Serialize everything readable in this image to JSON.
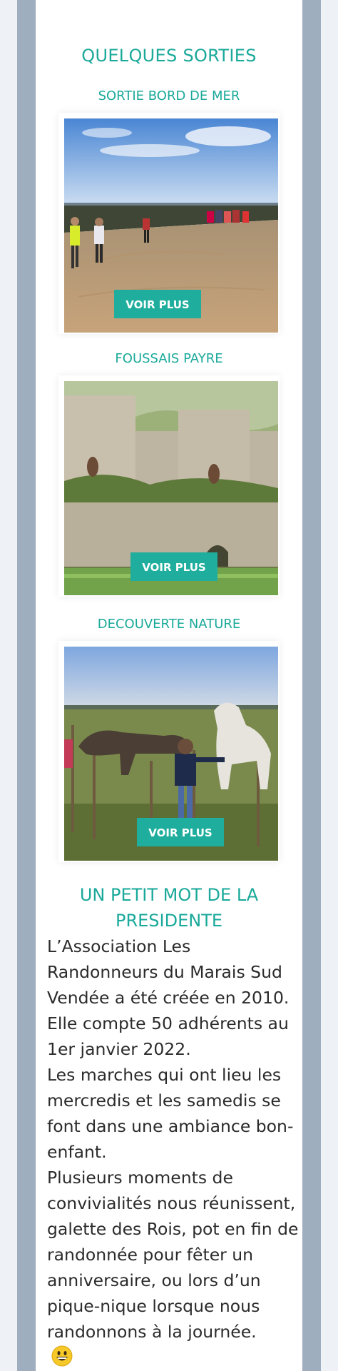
{
  "sorties": {
    "heading": "QUELQUES SORTIES",
    "cards": [
      {
        "title": "SORTIE BORD DE MER",
        "button": "VOIR PLUS",
        "image": "beach-walk-photo"
      },
      {
        "title": "FOUSSAIS PAYRE",
        "button": "VOIR PLUS",
        "image": "lime-kilns-photo"
      },
      {
        "title": "DECOUVERTE NATURE",
        "button": "VOIR PLUS",
        "image": "horses-photo"
      }
    ]
  },
  "president": {
    "heading_line1": "UN PETIT MOT DE LA",
    "heading_line2": "PRESIDENTE",
    "paragraphs": [
      "L’Association Les Randonneurs du Marais Sud Vendée a été créée en 2010. Elle compte 50 adhérents au 1er janvier 2022.",
      "Les marches qui ont lieu les mercredis et les samedis se font dans une ambiance bon-enfant.",
      "Plusieurs moments de convivialités nous réunissent, galette des Rois, pot en fin de randonnée pour fêter un anniversaire, ou lors d’un pique-nique lorsque nous randonnons à la journée."
    ],
    "emoji": "grinning-face-emoji"
  },
  "colors": {
    "accent": "#1aa99a",
    "button": "#1fae9d",
    "frame": "#9eaebe",
    "background": "#eef2f6"
  }
}
